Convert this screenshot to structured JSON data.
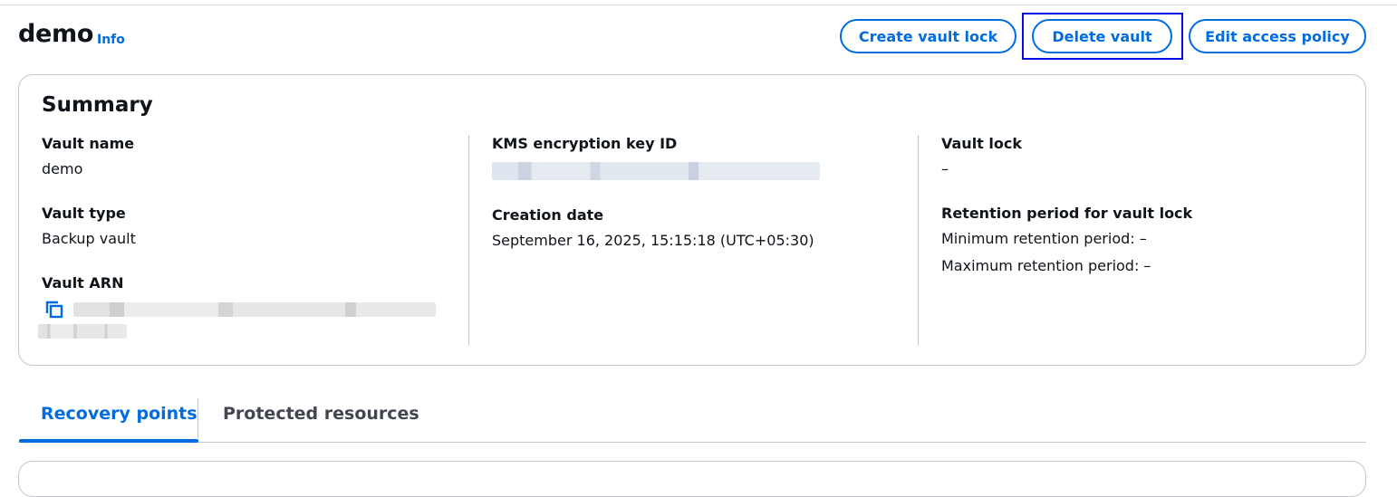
{
  "page": {
    "title": "demo",
    "info_link": "Info",
    "buttons": {
      "create_vault_lock": "Create vault lock",
      "delete_vault": "Delete vault",
      "edit_access_policy": "Edit access policy"
    }
  },
  "summary": {
    "title": "Summary",
    "vault_name": {
      "label": "Vault name",
      "value": "demo"
    },
    "vault_type": {
      "label": "Vault type",
      "value": "Backup vault"
    },
    "vault_arn": {
      "label": "Vault ARN",
      "copy_icon": "copy-icon"
    },
    "kms_key": {
      "label": "KMS encryption key ID"
    },
    "creation_date": {
      "label": "Creation date",
      "value": "September 16, 2025, 15:15:18 (UTC+05:30)"
    },
    "vault_lock": {
      "label": "Vault lock",
      "value": "–"
    },
    "retention": {
      "label": "Retention period for vault lock",
      "min": "Minimum retention period: –",
      "max": "Maximum retention period: –"
    }
  },
  "tabs": [
    {
      "label": "Recovery points",
      "active": true
    },
    {
      "label": "Protected resources",
      "active": false
    }
  ],
  "colors": {
    "accent": "#006ce0",
    "focus_ring": "#0010e6",
    "border": "#c6c6cd",
    "text": "#0f141a"
  }
}
